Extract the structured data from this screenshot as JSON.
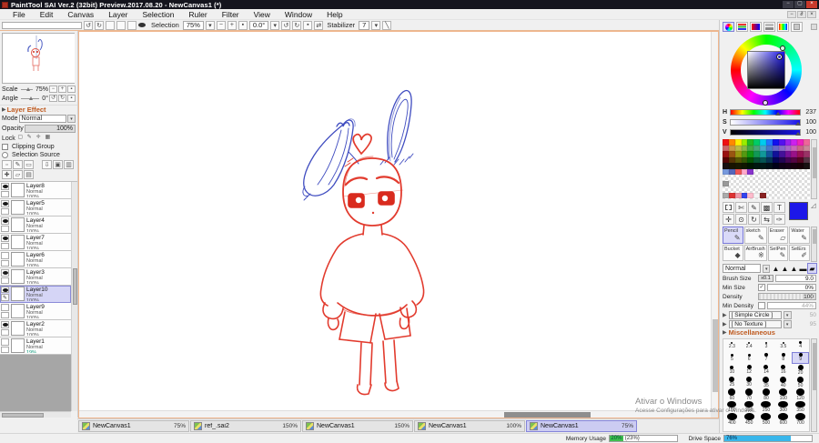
{
  "window": {
    "title": "PaintTool SAI Ver.2 (32bit) Preview.2017.08.20 - NewCanvas1 (*)"
  },
  "menu": {
    "items": [
      "File",
      "Edit",
      "Canvas",
      "Layer",
      "Selection",
      "Ruler",
      "Filter",
      "View",
      "Window",
      "Help"
    ]
  },
  "toolbar": {
    "selection_label": "Selection",
    "zoom_value": "75%",
    "angle_value": "0.0°",
    "stabilizer_label": "Stabilizer",
    "stabilizer_value": "7"
  },
  "navigator": {
    "scale_label": "Scale",
    "scale_value": "75%",
    "angle_label": "Angle",
    "angle_value": "0°"
  },
  "layer_panel": {
    "effect_label": "Layer Effect",
    "mode_label": "Mode",
    "mode_value": "Normal",
    "opacity_label": "Opacity",
    "opacity_value": "100%",
    "lock_label": "Lock",
    "clipping_label": "Clipping Group",
    "selection_source_label": "Selection Source",
    "layers": [
      {
        "name": "Layer8",
        "mode": "Normal",
        "opacity": "100%",
        "visible": true,
        "selected": false,
        "editing": false,
        "opacity_highlight": false
      },
      {
        "name": "Layer5",
        "mode": "Normal",
        "opacity": "100%",
        "visible": true,
        "selected": false,
        "editing": false,
        "opacity_highlight": false
      },
      {
        "name": "Layer4",
        "mode": "Normal",
        "opacity": "100%",
        "visible": true,
        "selected": false,
        "editing": false,
        "opacity_highlight": false
      },
      {
        "name": "Layer7",
        "mode": "Normal",
        "opacity": "100%",
        "visible": true,
        "selected": false,
        "editing": false,
        "opacity_highlight": false
      },
      {
        "name": "Layer6",
        "mode": "Normal",
        "opacity": "100%",
        "visible": false,
        "selected": false,
        "editing": false,
        "opacity_highlight": false
      },
      {
        "name": "Layer3",
        "mode": "Normal",
        "opacity": "100%",
        "visible": true,
        "selected": false,
        "editing": false,
        "opacity_highlight": false
      },
      {
        "name": "Layer10",
        "mode": "Normal",
        "opacity": "100%",
        "visible": true,
        "selected": true,
        "editing": true,
        "opacity_highlight": false
      },
      {
        "name": "Layer9",
        "mode": "Normal",
        "opacity": "100%",
        "visible": false,
        "selected": false,
        "editing": false,
        "opacity_highlight": false
      },
      {
        "name": "Layer2",
        "mode": "Normal",
        "opacity": "100%",
        "visible": true,
        "selected": false,
        "editing": false,
        "opacity_highlight": false
      },
      {
        "name": "Layer1",
        "mode": "Normal",
        "opacity": "19%",
        "visible": false,
        "selected": false,
        "editing": false,
        "opacity_highlight": true
      }
    ]
  },
  "color_panel": {
    "h_label": "H",
    "h_value": "237",
    "s_label": "S",
    "s_value": "100",
    "v_label": "V",
    "v_value": "100",
    "current_color": "#1c17e8",
    "palette": [
      [
        "#ee1111",
        "#ff8800",
        "#ffee00",
        "#99ee00",
        "#22bb22",
        "#00cc66",
        "#00ccee",
        "#2277ff",
        "#1111ee",
        "#5511ee",
        "#9922ee",
        "#cc22ee",
        "#ee22bb",
        "#ee6699"
      ],
      [
        "#cc6666",
        "#cc9944",
        "#bbbb44",
        "#88bb44",
        "#44aa44",
        "#44aa77",
        "#44aacc",
        "#4477cc",
        "#6666cc",
        "#8866cc",
        "#aa66cc",
        "#cc66bb",
        "#cc6688",
        "#cc8899"
      ],
      [
        "#991111",
        "#995511",
        "#999911",
        "#559911",
        "#119911",
        "#119955",
        "#119999",
        "#115599",
        "#111199",
        "#441199",
        "#771199",
        "#991188",
        "#991155",
        "#993366"
      ],
      [
        "#550505",
        "#553305",
        "#555505",
        "#335505",
        "#055505",
        "#055533",
        "#055555",
        "#053355",
        "#050555",
        "#220555",
        "#440555",
        "#550544",
        "#550522",
        "#553344"
      ],
      [
        "#181010",
        "#181400",
        "#181800",
        "#101800",
        "#001800",
        "#001810",
        "#001818",
        "#001018",
        "#000018",
        "#100018",
        "#160018",
        "#180010",
        "#180008",
        "#181012"
      ],
      [
        "#7799dd",
        "#5566bb",
        "#ee5555",
        "#ffaacc",
        "#8833cc",
        "",
        "",
        "",
        "",
        "",
        "",
        "",
        "",
        ""
      ],
      [
        "",
        "",
        "",
        "",
        "",
        "",
        "",
        "",
        "",
        "",
        "",
        "",
        "",
        ""
      ],
      [
        "#999999",
        "",
        "",
        "",
        "",
        "",
        "",
        "",
        "",
        "",
        "",
        "",
        "",
        ""
      ],
      [
        "",
        "",
        "",
        "",
        "",
        "",
        "",
        "",
        "",
        "",
        "",
        "",
        "",
        ""
      ],
      [
        "#aaaaaa",
        "#dd3333",
        "#ee99aa",
        "#3344ee",
        "#ffbbcc",
        "#f5f5f5",
        "#882222",
        "",
        "",
        "",
        "",
        "",
        "",
        ""
      ]
    ]
  },
  "tools": {
    "row1": [
      "marquee",
      "lasso",
      "selpen",
      "stamp",
      "text"
    ],
    "row2": [
      "move",
      "zoom",
      "rotate",
      "flip",
      "picker"
    ],
    "grid": [
      {
        "label": "Pencil",
        "selected": true
      },
      {
        "label": "sketch",
        "selected": false
      },
      {
        "label": "Eraser",
        "selected": false
      },
      {
        "label": "Water",
        "selected": false
      },
      {
        "label": "Bucket",
        "selected": false
      },
      {
        "label": "AirBrush",
        "selected": false
      },
      {
        "label": "SelPen",
        "selected": false
      },
      {
        "label": "SelErs",
        "selected": false
      }
    ],
    "blend_mode": "Normal",
    "tip_shapes": [
      {
        "name": "tip-triangle-1",
        "glyph": "▲",
        "selected": false
      },
      {
        "name": "tip-triangle-2",
        "glyph": "▲",
        "selected": false
      },
      {
        "name": "tip-triangle-3",
        "glyph": "▲",
        "selected": false
      },
      {
        "name": "tip-flat",
        "glyph": "▬",
        "selected": false
      },
      {
        "name": "tip-square",
        "glyph": "▰",
        "selected": true
      }
    ]
  },
  "brush": {
    "size_label": "Brush Size",
    "size_scale": "x0.1",
    "size_value": "9.0",
    "min_size_label": "Min Size",
    "min_size_value": "0%",
    "density_label": "Density",
    "density_value": "100",
    "min_density_label": "Min Density",
    "min_density_value": "44%",
    "shape_label": "[ Simple Circle ]",
    "shape_value": "50",
    "texture_label": "[ No Texture ]",
    "texture_value": "95",
    "misc_label": "Miscellaneous",
    "sizes": {
      "rows": [
        [
          "2.3",
          "2.4",
          "3",
          "3.5",
          "4"
        ],
        [
          "5",
          "6",
          "7",
          "8",
          "9"
        ],
        [
          "10",
          "12",
          "14",
          "16",
          "20"
        ],
        [
          "25",
          "30",
          "35",
          "40",
          "50"
        ],
        [
          "60",
          "70",
          "80",
          "100",
          "120"
        ],
        [
          "150",
          "200",
          "250",
          "300",
          "350"
        ],
        [
          "400",
          "450",
          "500",
          "600",
          "700"
        ]
      ],
      "selected": "9"
    }
  },
  "tabs": [
    {
      "title": "NewCanvas1",
      "zoom": "75%",
      "selected": false
    },
    {
      "title": "ref_.sai2",
      "zoom": "150%",
      "selected": false
    },
    {
      "title": "NewCanvas1",
      "zoom": "150%",
      "selected": false
    },
    {
      "title": "NewCanvas1",
      "zoom": "100%",
      "selected": false
    },
    {
      "title": "NewCanvas1",
      "zoom": "75%",
      "selected": true
    }
  ],
  "status": {
    "memory_label": "Memory Usage",
    "memory_percent": "20%",
    "memory_extra": "(23%)",
    "drive_label": "Drive Space",
    "drive_percent": "76%"
  },
  "watermark": {
    "line1": "Ativar o Windows",
    "line2": "Acesse Configurações para ativar o Windows."
  },
  "icons": {
    "undo": "↺",
    "redo": "↻",
    "minus": "−",
    "plus": "+",
    "stop": "▪",
    "rot-l": "↺",
    "rot-r": "↻",
    "swap": "⇄",
    "line": "╲",
    "dd": "▾",
    "play": "▶",
    "new": "▫",
    "pen": "✎",
    "folder": "▭",
    "down": "⇩",
    "mask": "▣",
    "fold": "▥",
    "add": "✚",
    "clear": "▱",
    "trash": "▤",
    "marquee": "▢",
    "lasso": "✄",
    "selpen": "✎",
    "stamp": "▩",
    "text": "T",
    "move": "✛",
    "zoom": "⊙",
    "rotate": "↻",
    "flip": "⇆",
    "picker": "✑",
    "close": "×",
    "min": "−",
    "max": "▢",
    "restore": "∂",
    "lock1": "▢",
    "lock2": "✎",
    "lock3": "✛",
    "lock4": "▦",
    "check": "✓",
    "corner": "◿"
  }
}
